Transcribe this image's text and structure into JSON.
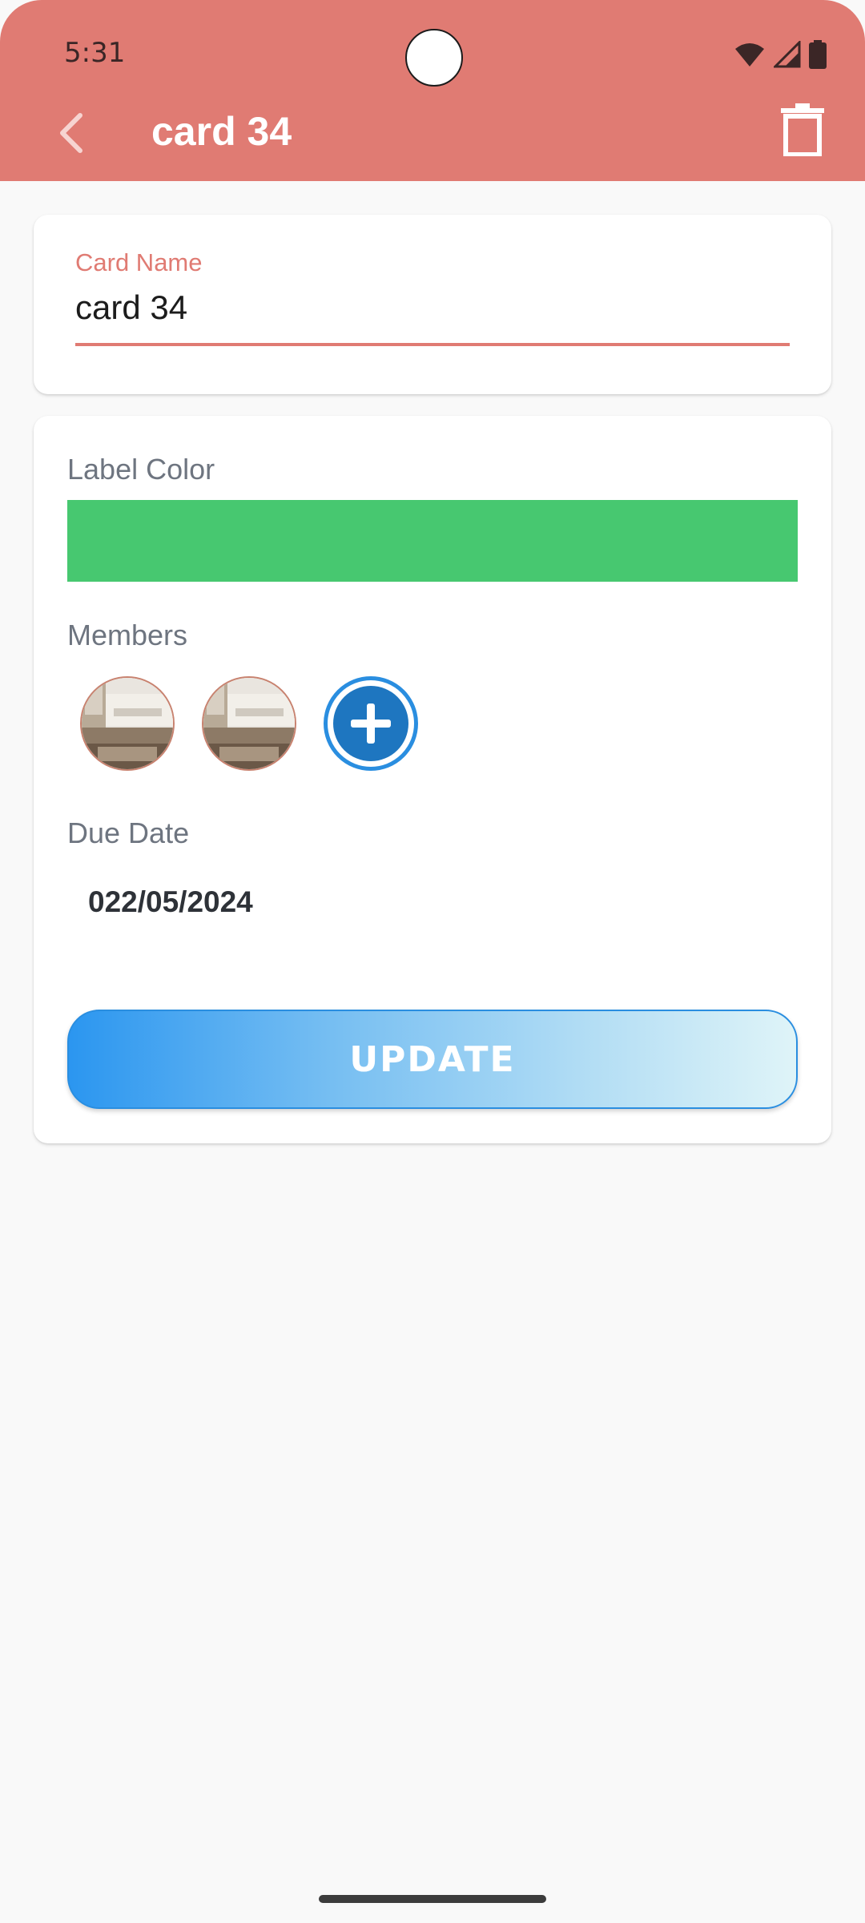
{
  "status_bar": {
    "time": "5:31"
  },
  "toolbar": {
    "title": "card 34"
  },
  "card_name": {
    "label": "Card Name",
    "value": "card 34"
  },
  "label_color": {
    "label": "Label Color",
    "color": "#47c870"
  },
  "members": {
    "label": "Members",
    "count": 2
  },
  "due_date": {
    "label": "Due Date",
    "value": "022/05/2024"
  },
  "actions": {
    "update_label": "UPDATE"
  },
  "colors": {
    "accent": "#e07b73",
    "primary_blue": "#2a8ee0"
  }
}
